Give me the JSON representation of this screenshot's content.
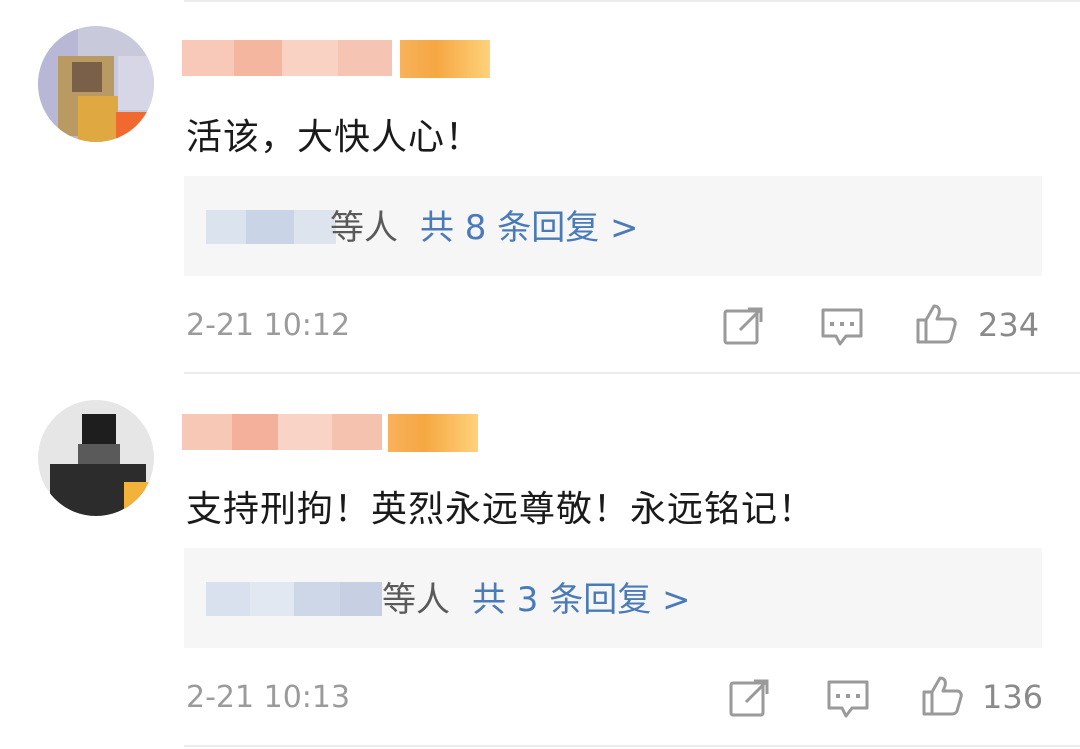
{
  "comments": [
    {
      "text": "活该，大快人心！",
      "reply_who": "等人",
      "reply_link": "共 8 条回复 >",
      "time": "2-21 10:12",
      "likes": "234"
    },
    {
      "text": "支持刑拘！英烈永远尊敬！永远铭记！",
      "reply_who": "等人",
      "reply_link": "共 3 条回复 >",
      "time": "2-21 10:13",
      "likes": "136"
    }
  ],
  "colors": {
    "link": "#4a7ab8",
    "text": "#1a1a1a",
    "meta": "#9b9b9b",
    "reply_bg": "#f6f6f6"
  },
  "icons": [
    "share-icon",
    "comment-icon",
    "like-icon"
  ]
}
